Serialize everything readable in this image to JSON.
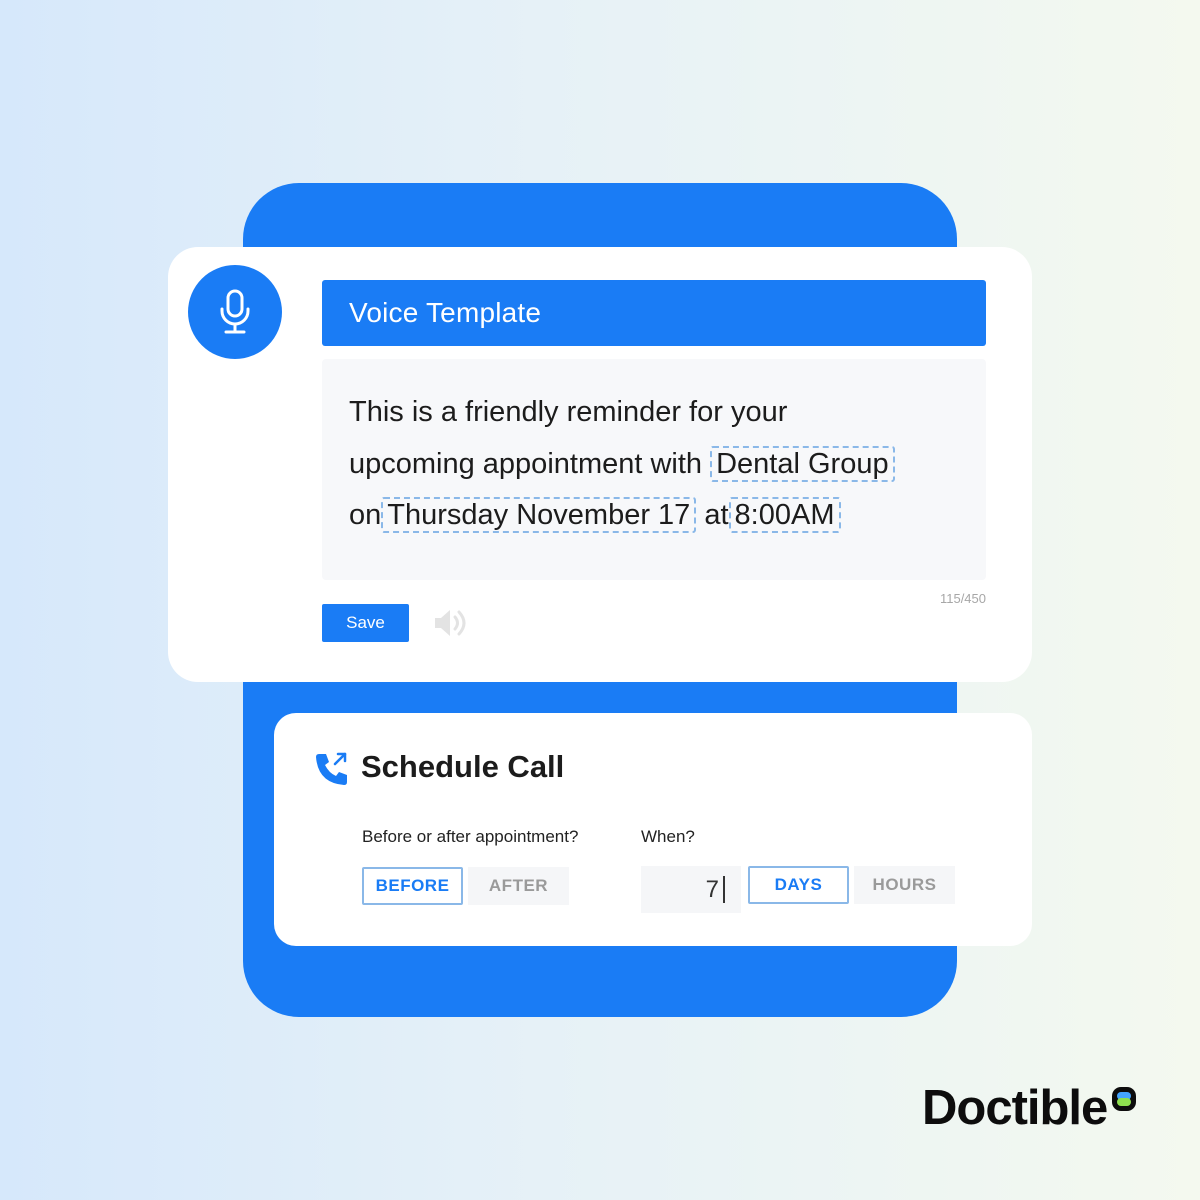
{
  "voice_template": {
    "title": "Voice Template",
    "message": {
      "line1": "This is a friendly reminder for your",
      "line2_prefix": "upcoming appointment with",
      "practice_token": "Dental Group",
      "line3_prefix": "on",
      "date_token": "Thursday November 17",
      "line3_mid": "at",
      "time_token": "8:00AM"
    },
    "char_count": "115/450",
    "save_label": "Save",
    "icons": {
      "mic": "microphone-icon",
      "speaker": "speaker-icon"
    }
  },
  "schedule_call": {
    "title": "Schedule Call",
    "icon": "phone-outgoing-icon",
    "timing_label": "Before or after appointment?",
    "timing_options": [
      "BEFORE",
      "AFTER"
    ],
    "timing_selected": "BEFORE",
    "when_label": "When?",
    "when_value": "7",
    "unit_options": [
      "DAYS",
      "HOURS"
    ],
    "unit_selected": "DAYS"
  },
  "brand": {
    "name": "Doctible"
  },
  "colors": {
    "accent": "#1a7cf5",
    "token_border": "#8ab8e8",
    "muted": "#9a9a9a"
  }
}
